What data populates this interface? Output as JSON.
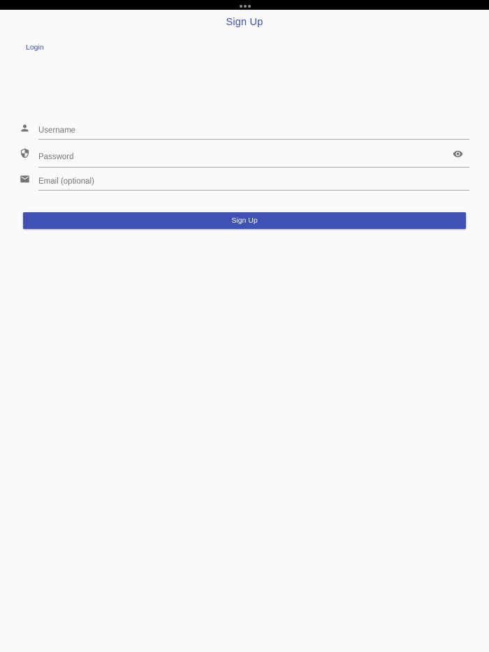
{
  "colors": {
    "accent": "#3f51b5",
    "background": "#fafafa",
    "icon": "#757575"
  },
  "header": {
    "title": "Sign Up"
  },
  "nav": {
    "login_label": "Login"
  },
  "form": {
    "username": {
      "icon": "person-icon",
      "placeholder": "Username",
      "value": ""
    },
    "password": {
      "icon": "shield-icon",
      "placeholder": "Password",
      "value": "",
      "toggle_icon": "eye-icon"
    },
    "email": {
      "icon": "mail-icon",
      "placeholder": "Email (optional)",
      "value": ""
    },
    "submit_label": "Sign Up"
  }
}
